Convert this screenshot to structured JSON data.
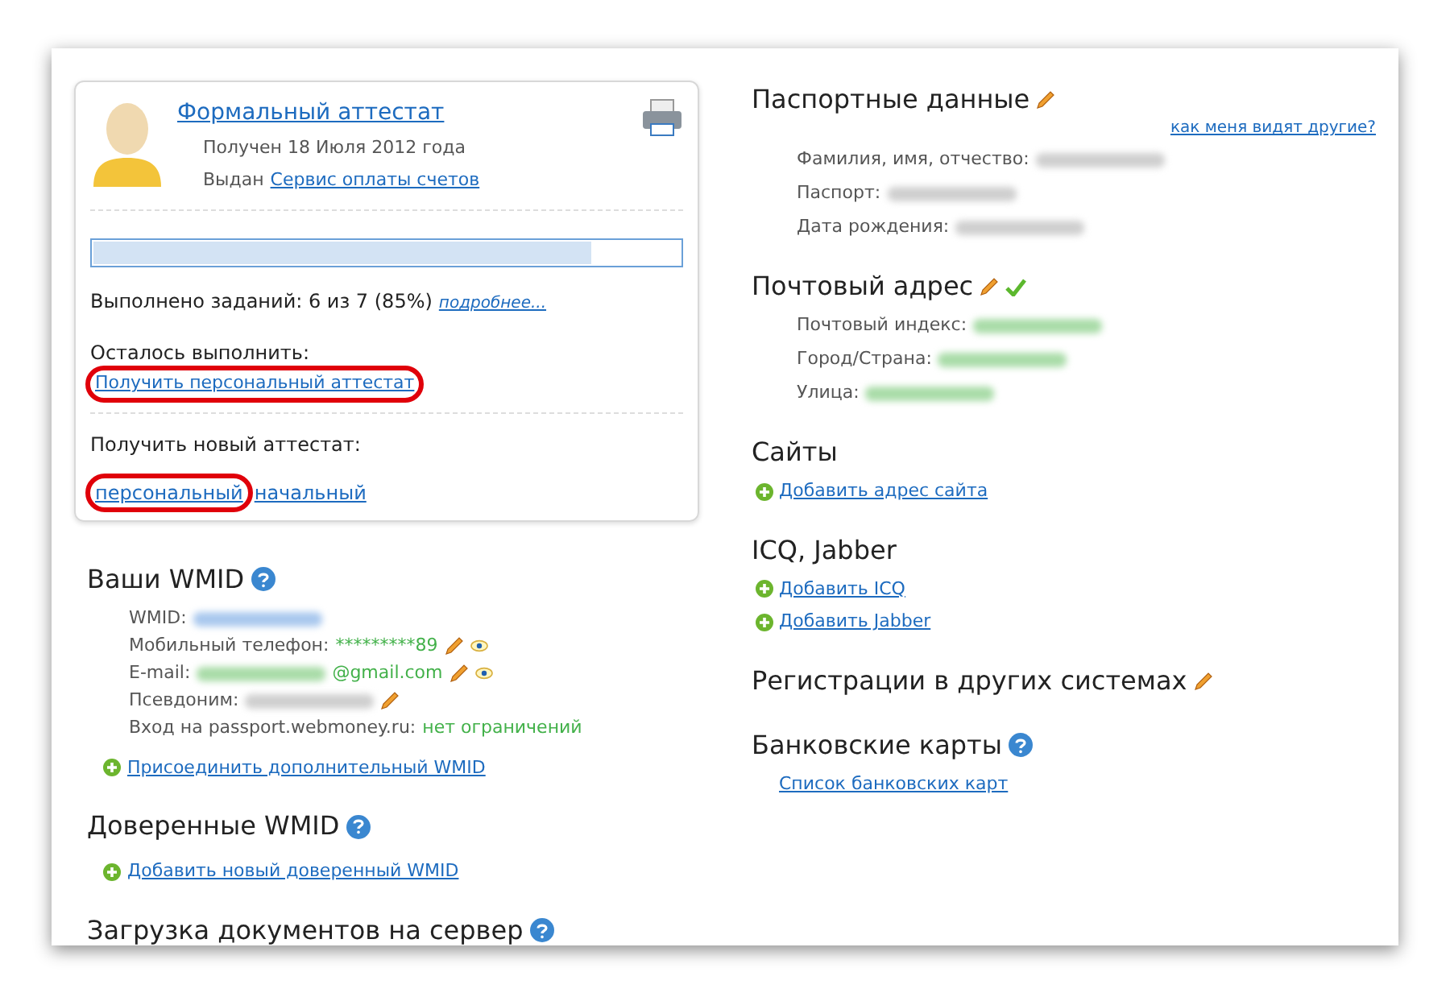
{
  "certificate": {
    "title": "Формальный аттестат",
    "received": "Получен 18 Июля 2012 года",
    "issued_label": "Выдан",
    "issuer": "Сервис оплаты счетов",
    "level": 0.85,
    "tasks_text": "Выполнено заданий: 6 из 7 (85%)",
    "more_link": "подробнее...",
    "remaining_label": "Осталось выполнить:",
    "remaining_links": [
      {
        "label": "Получить персональный аттестат",
        "highlighted": true
      }
    ],
    "new_label": "Получить новый аттестат:",
    "new_links": [
      {
        "label": "персональный",
        "highlighted": true
      },
      {
        "label": "начальный",
        "highlighted": false
      }
    ]
  },
  "left_sections": [
    {
      "heading": "Ваши WMID",
      "help": true,
      "rows": [
        {
          "label": "WMID:",
          "kind": "link",
          "blurred": true
        },
        {
          "label": "Мобильный телефон:",
          "kind": "green",
          "value": "*********89",
          "edit": true,
          "view": true
        },
        {
          "label": "E-mail:",
          "kind": "green",
          "blurred": true,
          "value": "@gmail.com",
          "edit": true,
          "view": true
        },
        {
          "label": "Псевдоним:",
          "kind": "plain",
          "blurred": true,
          "edit": true
        },
        {
          "label": "Вход на passport.webmoney.ru:",
          "kind": "green",
          "value": "нет ограничений"
        }
      ],
      "links": [
        {
          "label": "Присоединить дополнительный WMID",
          "plus": true
        }
      ]
    },
    {
      "heading": "Доверенные WMID",
      "help": true,
      "links": [
        {
          "label": "Добавить новый доверенный WMID",
          "plus": true
        }
      ]
    },
    {
      "heading": "Загрузка документов на сервер",
      "help": true
    }
  ],
  "right_sections": [
    {
      "heading": "Паспортные данные",
      "edit": true,
      "corner_link": "как меня видят другие?",
      "rows": [
        {
          "label": "Фамилия, имя, отчество:",
          "kind": "plain",
          "blurred": true
        },
        {
          "label": "Паспорт:",
          "kind": "plain",
          "blurred": true
        },
        {
          "label": "Дата рождения:",
          "kind": "plain",
          "blurred": true
        }
      ]
    },
    {
      "heading": "Почтовый адрес",
      "edit": true,
      "check": true,
      "rows": [
        {
          "label": "Почтовый индекс:",
          "kind": "green",
          "blurred": true
        },
        {
          "label": "Город/Страна:",
          "kind": "green",
          "blurred": true
        },
        {
          "label": "Улица:",
          "kind": "green",
          "blurred": true
        }
      ]
    },
    {
      "heading": "Сайты",
      "links": [
        {
          "label": "Добавить адрес сайта",
          "plus": true
        }
      ]
    },
    {
      "heading": "ICQ, Jabber",
      "links": [
        {
          "label": "Добавить ICQ",
          "plus": true
        },
        {
          "label": "Добавить Jabber",
          "plus": true
        }
      ]
    },
    {
      "heading": "Регистрации в других системах",
      "edit": true
    },
    {
      "heading": "Банковские карты",
      "help": true,
      "links": [
        {
          "label": "Список банковских карт",
          "plus": false
        }
      ]
    }
  ]
}
